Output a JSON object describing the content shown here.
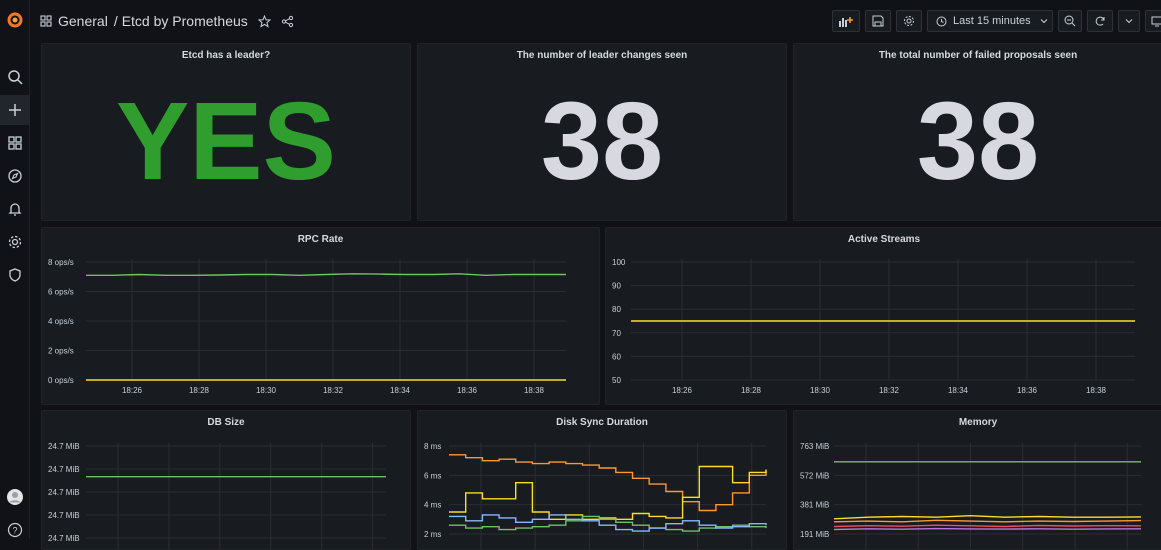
{
  "breadcrumb": {
    "folder": "General",
    "separator": "/",
    "dashboard": "Etcd by Prometheus"
  },
  "toolbar": {
    "time_range": "Last 15 minutes"
  },
  "colors": {
    "green": "#37872d",
    "yes_green": "#2f9e2f",
    "orange": "#ff9830",
    "yellow": "#fade2a",
    "light_green": "#73bf69",
    "blue": "#5794f2",
    "cyan": "#8ab8ff"
  },
  "stats": [
    {
      "title": "Etcd has a leader?",
      "value": "YES"
    },
    {
      "title": "The number of leader changes seen",
      "value": "38"
    },
    {
      "title": "The total number of failed proposals seen",
      "value": "38"
    }
  ],
  "panels": {
    "rpc": {
      "title": "RPC Rate"
    },
    "streams": {
      "title": "Active Streams"
    },
    "db": {
      "title": "DB Size"
    },
    "disk": {
      "title": "Disk Sync Duration"
    },
    "memory": {
      "title": "Memory"
    }
  },
  "chart_data": [
    {
      "id": "rpc",
      "type": "line",
      "title": "RPC Rate",
      "x": [
        "18:26",
        "18:28",
        "18:30",
        "18:32",
        "18:34",
        "18:36",
        "18:38"
      ],
      "yticks": [
        "0 ops/s",
        "2 ops/s",
        "4 ops/s",
        "6 ops/s",
        "8 ops/s"
      ],
      "ylim": [
        0,
        8
      ],
      "series": [
        {
          "color": "#73bf69",
          "values": [
            7.1,
            7.1,
            7.15,
            7.1,
            7.1,
            7.12,
            7.15,
            7.15,
            7.1,
            7.15,
            7.2,
            7.18,
            7.15,
            7.15,
            7.2,
            7.1,
            7.15,
            7.15,
            7.15
          ]
        },
        {
          "color": "#fade2a",
          "values": [
            0,
            0,
            0,
            0,
            0,
            0,
            0,
            0,
            0,
            0,
            0,
            0,
            0,
            0,
            0,
            0,
            0,
            0,
            0
          ]
        }
      ]
    },
    {
      "id": "streams",
      "type": "line",
      "title": "Active Streams",
      "x": [
        "18:26",
        "18:28",
        "18:30",
        "18:32",
        "18:34",
        "18:36",
        "18:38"
      ],
      "yticks": [
        "50",
        "60",
        "70",
        "80",
        "90",
        "100"
      ],
      "ylim": [
        50,
        100
      ],
      "series": [
        {
          "color": "#fade2a",
          "values": [
            75,
            75,
            75,
            75,
            75,
            75,
            75,
            75,
            75,
            75,
            75,
            75,
            75,
            75,
            75,
            75,
            75,
            75,
            75
          ]
        }
      ]
    },
    {
      "id": "db",
      "type": "line",
      "title": "DB Size",
      "yticks": [
        "24.7 MiB",
        "24.7 MiB",
        "24.7 MiB",
        "24.7 MiB",
        "24.7 MiB"
      ],
      "series": [
        {
          "color": "#73bf69",
          "values": [
            24.7,
            24.7,
            24.7,
            24.7,
            24.7,
            24.7,
            24.7,
            24.7,
            24.7,
            24.7
          ]
        }
      ]
    },
    {
      "id": "disk",
      "type": "line",
      "title": "Disk Sync Duration",
      "yticks": [
        "2 ms",
        "4 ms",
        "6 ms",
        "8 ms"
      ],
      "series": [
        {
          "color": "#ff9830",
          "values": [
            7.4,
            7.2,
            7.0,
            7.1,
            6.9,
            6.8,
            6.9,
            6.8,
            6.7,
            6.5,
            6.2,
            5.8,
            5.4,
            4.9,
            4.2,
            3.6,
            4.0,
            4.8,
            6.0,
            6.3
          ]
        },
        {
          "color": "#fade2a",
          "values": [
            3.5,
            4.8,
            4.4,
            4.4,
            5.5,
            3.5,
            3.0,
            3.3,
            3.0,
            3.1,
            3.0,
            3.4,
            3.2,
            3.1,
            4.5,
            6.6,
            6.6,
            5.5,
            6.2,
            6.4
          ]
        },
        {
          "color": "#73bf69",
          "values": [
            2.6,
            2.4,
            2.5,
            2.3,
            2.4,
            2.5,
            2.6,
            2.9,
            3.2,
            3.0,
            2.8,
            2.6,
            2.4,
            2.3,
            2.2,
            2.4,
            2.5,
            2.6,
            2.5,
            2.4
          ]
        },
        {
          "color": "#8ab8ff",
          "values": [
            3.2,
            2.9,
            3.3,
            3.1,
            2.8,
            3.0,
            3.3,
            3.0,
            2.9,
            2.6,
            2.3,
            2.2,
            2.4,
            2.7,
            2.9,
            2.6,
            2.4,
            2.5,
            2.7,
            2.6
          ]
        }
      ]
    },
    {
      "id": "memory",
      "type": "line",
      "title": "Memory",
      "yticks": [
        "191 MiB",
        "381 MiB",
        "572 MiB",
        "763 MiB"
      ],
      "series": [
        {
          "color": "#73bf69",
          "values": [
            660,
            660,
            660,
            660,
            660,
            660,
            660,
            660,
            660,
            660
          ]
        },
        {
          "color": "#fade2a",
          "values": [
            290,
            300,
            305,
            300,
            310,
            300,
            305,
            300,
            300,
            302
          ]
        },
        {
          "color": "#ff9830",
          "values": [
            270,
            275,
            270,
            280,
            275,
            270,
            275,
            272,
            275,
            278
          ]
        },
        {
          "color": "#f2495c",
          "values": [
            240,
            245,
            242,
            248,
            244,
            240,
            246,
            243,
            245,
            244
          ]
        },
        {
          "color": "#b877d9",
          "values": [
            220,
            225,
            222,
            226,
            224,
            223,
            225,
            222,
            224,
            225
          ]
        }
      ]
    }
  ]
}
